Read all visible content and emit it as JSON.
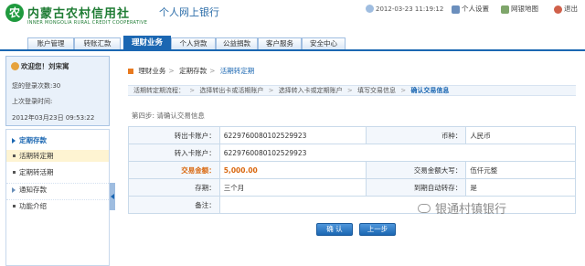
{
  "header": {
    "logo_mark": "农",
    "logo_cn": "内蒙古农村信用社",
    "logo_en": "INNER MONGOLIA RURAL CREDIT COOPERATIVE",
    "title": "个人网上银行",
    "datetime": "2012-03-23 11:19:12",
    "settings_label": "个人设置",
    "sitemap_label": "网银地图",
    "exit_label": "退出"
  },
  "nav": {
    "tabs": [
      "账户管理",
      "转账汇款",
      "理财业务",
      "个人贷款",
      "公益捐款",
      "客户服务",
      "安全中心"
    ],
    "active_index": 2
  },
  "sidebar": {
    "greeting": "欢迎您！刘宋寓",
    "login_count": "您的登录次数:30",
    "last_login_label": "上次登录时间:",
    "last_login_time": "2012年03月23日 09:53:22",
    "menu": {
      "group": "定期存款",
      "sub_items": [
        "活期转定期",
        "定期转活期"
      ],
      "selected": 0,
      "other_items": [
        "通知存款",
        "功能介绍"
      ]
    }
  },
  "breadcrumb": [
    "理财业务",
    "定期存款",
    "活期转定期"
  ],
  "steps": {
    "prefix": "活期转定期流程：",
    "items": [
      "选择转出卡或活期账户",
      "选择转入卡或定期账户",
      "填写交易信息",
      "确认交易信息"
    ],
    "current": 3
  },
  "step_title": "第四步: 请确认交易信息",
  "form": {
    "from_label": "转出卡账户：",
    "from_value": "6229760080102529923",
    "currency_label": "币种：",
    "currency_value": "人民币",
    "to_label": "转入卡账户：",
    "to_value": "6229760080102529923",
    "amount_label": "交易金额：",
    "amount_value": "5,000.00",
    "amount_cap_label": "交易金额大写：",
    "amount_cap_value": "伍仟元整",
    "term_label": "存期：",
    "term_value": "三个月",
    "auto_label": "到期自动转存：",
    "auto_value": "是",
    "remark_label": "备注：",
    "remark_value": ""
  },
  "buttons": {
    "confirm": "确 认",
    "previous": "上一步"
  },
  "watermark": "银通村镇银行",
  "colors": {
    "brand_blue": "#1b67b2",
    "brand_green": "#1f7c34",
    "highlight": "#d9670e"
  }
}
